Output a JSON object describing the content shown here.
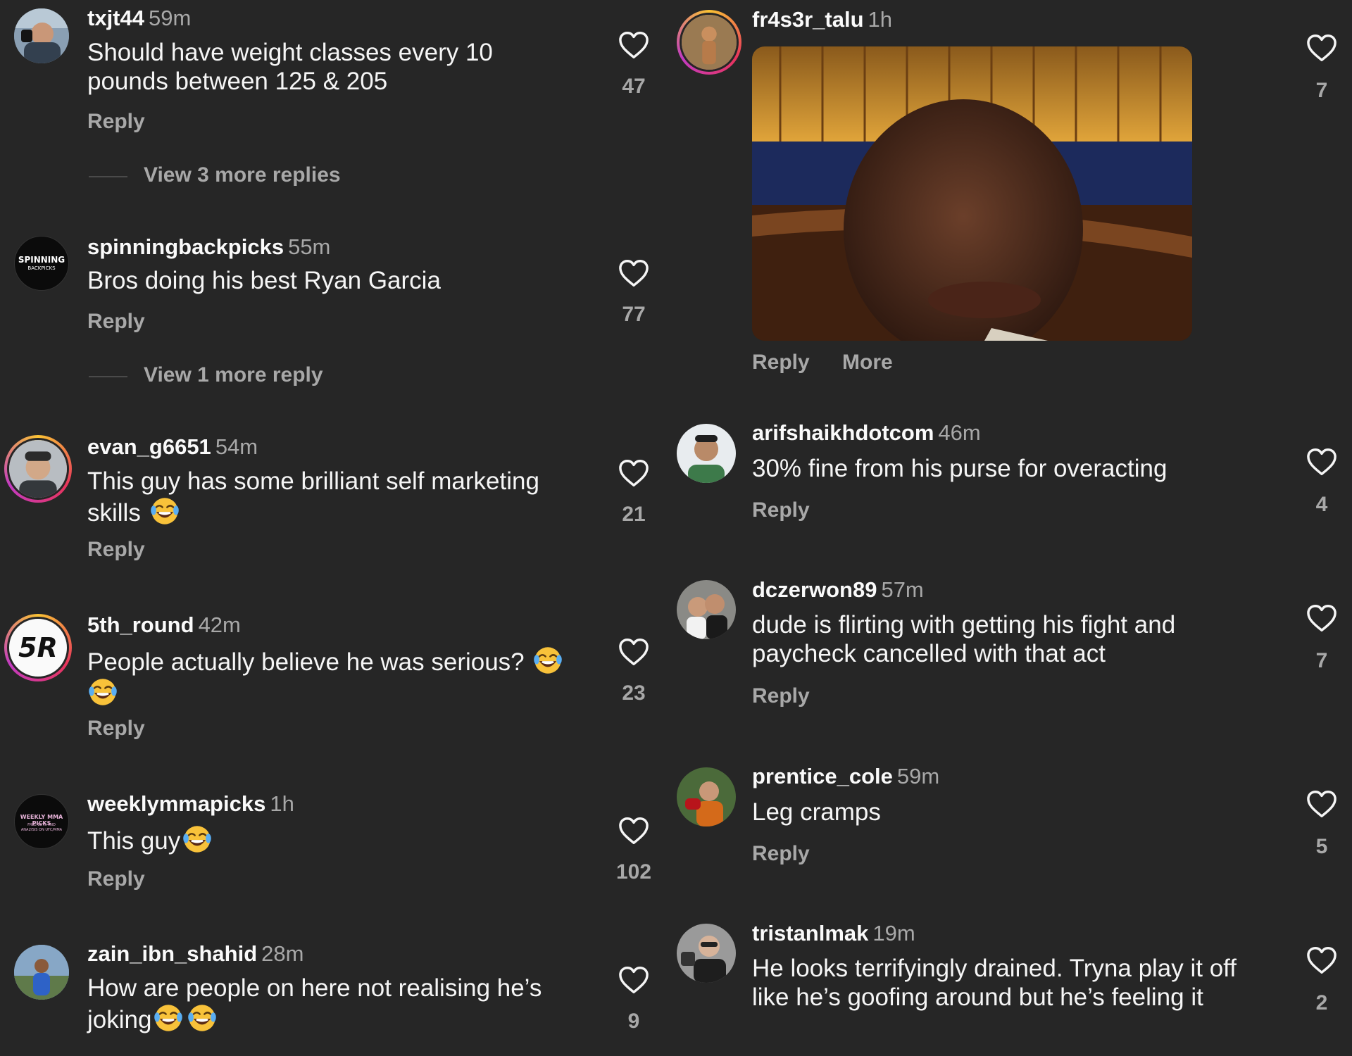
{
  "left_comments": [
    {
      "username": "txjt44",
      "time": "59m",
      "text": "Should have weight classes every 10 pounds between 125 & 205",
      "emojis": 0,
      "reply": "Reply",
      "likes": "47",
      "view_replies": "View 3 more replies"
    },
    {
      "username": "spinningbackpicks",
      "time": "55m",
      "text": "Bros doing his best Ryan Garcia",
      "emojis": 0,
      "reply": "Reply",
      "likes": "77",
      "view_replies": "View 1 more reply",
      "avatar_text": "SPINNING",
      "avatar_subtext": "BACKPICKS"
    },
    {
      "username": "evan_g6651",
      "time": "54m",
      "text": "This guy has some brilliant self marketing skills",
      "emojis": 1,
      "reply": "Reply",
      "likes": "21"
    },
    {
      "username": "5th_round",
      "time": "42m",
      "text": "People actually believe he was serious?",
      "emojis": 2,
      "reply": "Reply",
      "likes": "23",
      "avatar_text": "5R"
    },
    {
      "username": "weeklymmapicks",
      "time": "1h",
      "text": "This guy",
      "emojis": 1,
      "reply": "Reply",
      "likes": "102",
      "avatar_text": "WEEKLY MMA PICKS",
      "avatar_subtext": "FREE BETS AND ANALYSIS ON UFC/MMA"
    },
    {
      "username": "zain_ibn_shahid",
      "time": "28m",
      "text": "How are people on here not realising he’s joking",
      "emojis": 2,
      "reply": "Reply",
      "likes": "9"
    }
  ],
  "right_comments": [
    {
      "username": "fr4s3r_talu",
      "time": "1h",
      "reply": "Reply",
      "more": "More",
      "likes": "7"
    },
    {
      "username": "arifshaikhdotcom",
      "time": "46m",
      "text": "30% fine from his purse for overacting",
      "reply": "Reply",
      "likes": "4"
    },
    {
      "username": "dczerwon89",
      "time": "57m",
      "text": "dude is flirting with getting his fight and paycheck cancelled with that act",
      "reply": "Reply",
      "likes": "7"
    },
    {
      "username": "prentice_cole",
      "time": "59m",
      "text": "Leg cramps",
      "reply": "Reply",
      "likes": "5"
    },
    {
      "username": "tristanlmak",
      "time": "19m",
      "text": "He looks terrifyingly drained. Tryna play it off like he’s goofing around but he’s feeling it",
      "reply": "Reply",
      "likes": "2"
    }
  ],
  "colors": {
    "background": "#262626",
    "secondary_text": "#a8a8a8",
    "primary_text": "#f5f5f5",
    "story_ring": "#e8345c"
  },
  "icons": {
    "like": "heart-outline-icon",
    "emoji": "face-with-tears-of-joy-icon"
  }
}
